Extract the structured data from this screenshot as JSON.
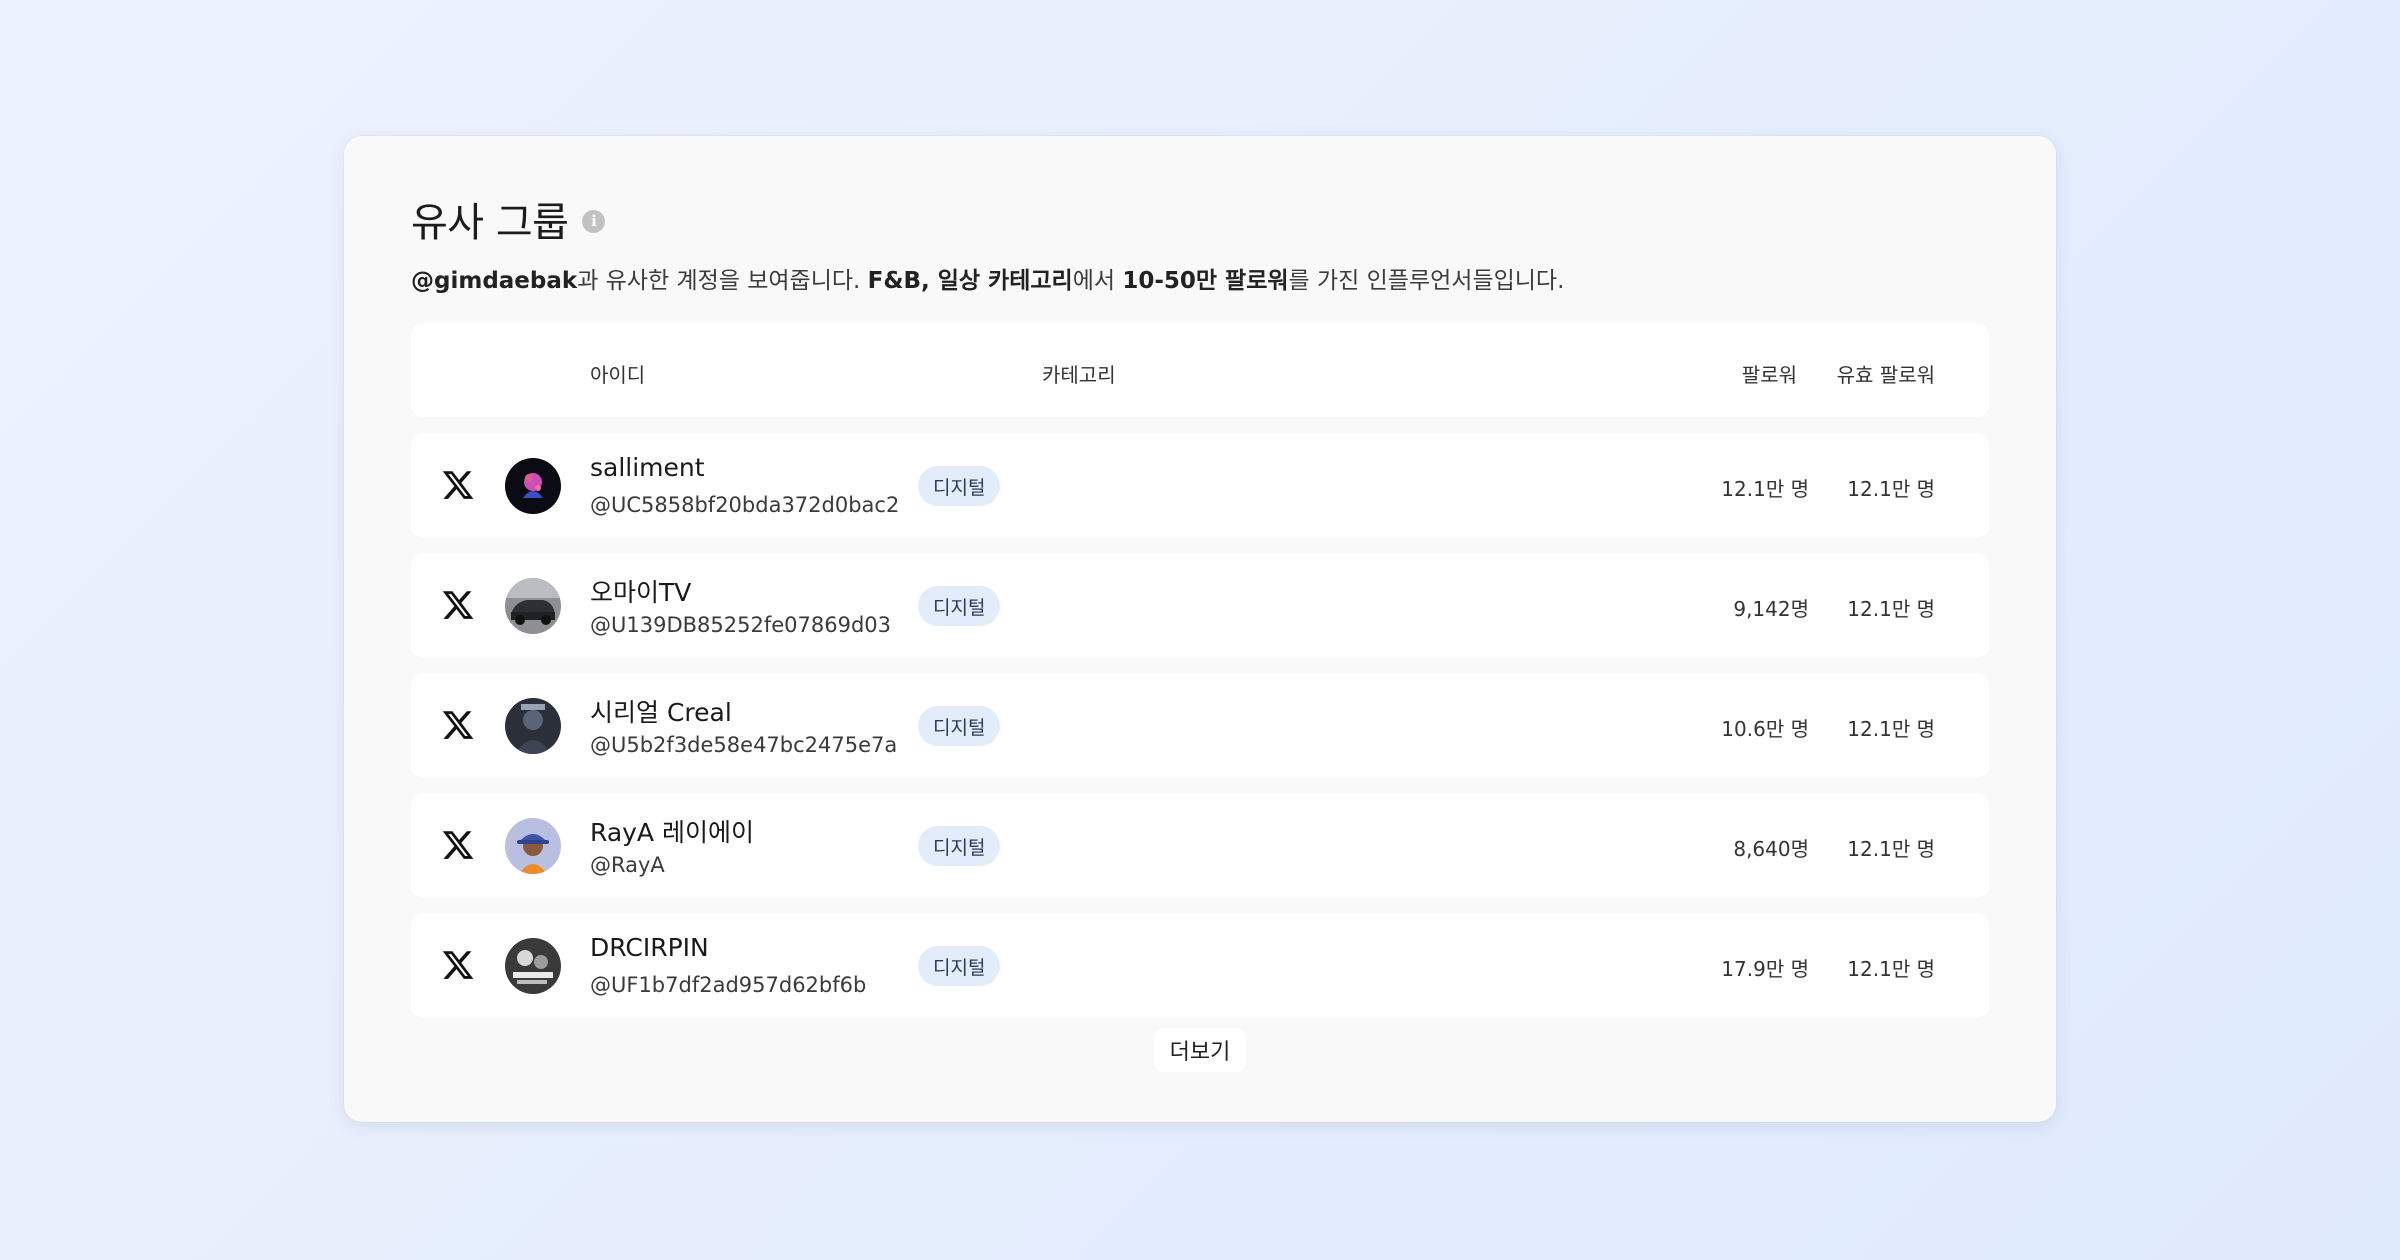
{
  "section": {
    "title": "유사 그룹",
    "description": {
      "handle": "@gimdaebak",
      "part1": "과 유사한 계정을 보여줍니다. ",
      "categories": "F&B, 일상 카테고리",
      "part2": "에서 ",
      "range": "10-50만 팔로워",
      "part3": "를 가진 인플루언서들입니다."
    }
  },
  "table": {
    "headers": {
      "id": "아이디",
      "category": "카테고리",
      "followers": "팔로워",
      "effective_followers": "유효 팔로워"
    },
    "rows": [
      {
        "platform_icon": "x-logo-icon",
        "avatar": "avatar-illustration",
        "name": "salliment",
        "handle": "@UC5858bf20bda372d0bac2",
        "category": "디지털",
        "followers": "12.1만 명",
        "effective_followers": "12.1만 명"
      },
      {
        "platform_icon": "x-logo-icon",
        "avatar": "avatar-car",
        "name": "오마이TV",
        "handle": "@U139DB85252fe07869d03",
        "category": "디지털",
        "followers": "9,142명",
        "effective_followers": "12.1만 명"
      },
      {
        "platform_icon": "x-logo-icon",
        "avatar": "avatar-dark-character",
        "name": "시리얼 Creal",
        "handle": "@U5b2f3de58e47bc2475e7a",
        "category": "디지털",
        "followers": "10.6만 명",
        "effective_followers": "12.1만 명"
      },
      {
        "platform_icon": "x-logo-icon",
        "avatar": "avatar-person-hat",
        "name": "RayA 레이에이",
        "handle": "@RayA",
        "category": "디지털",
        "followers": "8,640명",
        "effective_followers": "12.1만 명"
      },
      {
        "platform_icon": "x-logo-icon",
        "avatar": "avatar-bw-poster",
        "name": "DRCIRPIN",
        "handle": "@UF1b7df2ad957d62bf6b",
        "category": "디지털",
        "followers": "17.9만 명",
        "effective_followers": "12.1만 명"
      }
    ]
  },
  "more_button": "더보기",
  "colors": {
    "background": "#e6eefd",
    "card": "#f9f9f9",
    "badge_bg": "#e2ecfb",
    "badge_text": "#2b3a55"
  }
}
